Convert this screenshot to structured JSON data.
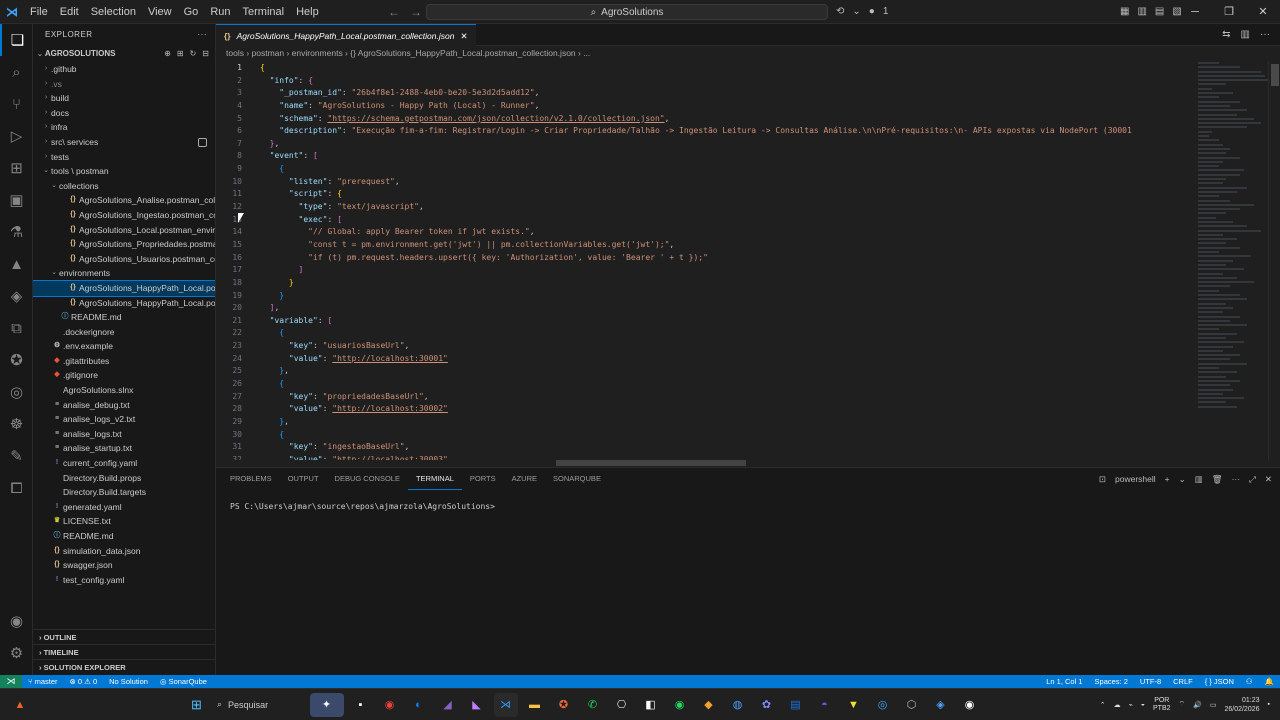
{
  "window": {
    "menu": [
      "File",
      "Edit",
      "Selection",
      "View",
      "Go",
      "Run",
      "Terminal",
      "Help"
    ],
    "search_text": "AgroSolutions",
    "notification_count": "1"
  },
  "explorer": {
    "title": "EXPLORER",
    "root": "AGROSOLUTIONS",
    "items": [
      {
        "label": ".github",
        "indent": 0,
        "chevron": "›",
        "icon": "",
        "icon_color": "#cccccc",
        "dim": false
      },
      {
        "label": ".vs",
        "indent": 0,
        "chevron": "›",
        "icon": "",
        "icon_color": "#cccccc",
        "dim": true
      },
      {
        "label": "build",
        "indent": 0,
        "chevron": "›",
        "icon": "",
        "icon_color": "#cccccc",
        "dim": false
      },
      {
        "label": "docs",
        "indent": 0,
        "chevron": "›",
        "icon": "",
        "icon_color": "#cccccc",
        "dim": false
      },
      {
        "label": "infra",
        "indent": 0,
        "chevron": "›",
        "icon": "",
        "icon_color": "#cccccc",
        "dim": false
      },
      {
        "label": "src\\ services",
        "indent": 0,
        "chevron": "›",
        "icon": "",
        "icon_color": "#cccccc",
        "dim": false,
        "badge": true
      },
      {
        "label": "tests",
        "indent": 0,
        "chevron": "›",
        "icon": "",
        "icon_color": "#cccccc",
        "dim": false
      },
      {
        "label": "tools \\ postman",
        "indent": 0,
        "chevron": "⌄",
        "icon": "",
        "icon_color": "#cccccc",
        "dim": false
      },
      {
        "label": "collections",
        "indent": 1,
        "chevron": "⌄",
        "icon": "",
        "icon_color": "#cccccc",
        "dim": false
      },
      {
        "label": "AgroSolutions_Analise.postman_collec...",
        "indent": 2,
        "chevron": "",
        "icon": "{}",
        "icon_color": "#e2c08d",
        "dim": false
      },
      {
        "label": "AgroSolutions_Ingestao.postman_coll...",
        "indent": 2,
        "chevron": "",
        "icon": "{}",
        "icon_color": "#e2c08d",
        "dim": false
      },
      {
        "label": "AgroSolutions_Local.postman_environ...",
        "indent": 2,
        "chevron": "",
        "icon": "{}",
        "icon_color": "#e2c08d",
        "dim": false
      },
      {
        "label": "AgroSolutions_Propriedades.postman...",
        "indent": 2,
        "chevron": "",
        "icon": "{}",
        "icon_color": "#e2c08d",
        "dim": false
      },
      {
        "label": "AgroSolutions_Usuarios.postman_coll...",
        "indent": 2,
        "chevron": "",
        "icon": "{}",
        "icon_color": "#e2c08d",
        "dim": false
      },
      {
        "label": "environments",
        "indent": 1,
        "chevron": "⌄",
        "icon": "",
        "icon_color": "#cccccc",
        "dim": false
      },
      {
        "label": "AgroSolutions_HappyPath_Local.post...",
        "indent": 2,
        "chevron": "",
        "icon": "{}",
        "icon_color": "#e2c08d",
        "dim": false,
        "selected": true
      },
      {
        "label": "AgroSolutions_HappyPath_Local.post...",
        "indent": 2,
        "chevron": "",
        "icon": "{}",
        "icon_color": "#e2c08d",
        "dim": false
      },
      {
        "label": "README.md",
        "indent": 1,
        "chevron": "",
        "icon": "ⓘ",
        "icon_color": "#519aba",
        "dim": false
      },
      {
        "label": ".dockerignore",
        "indent": 0,
        "chevron": "",
        "icon": "",
        "icon_color": "#cccccc",
        "dim": false
      },
      {
        "label": ".env.example",
        "indent": 0,
        "chevron": "",
        "icon": "⚙",
        "icon_color": "#cccccc",
        "dim": false
      },
      {
        "label": ".gitattributes",
        "indent": 0,
        "chevron": "",
        "icon": "◆",
        "icon_color": "#f05033",
        "dim": false
      },
      {
        "label": ".gitignore",
        "indent": 0,
        "chevron": "",
        "icon": "◆",
        "icon_color": "#f05033",
        "dim": false
      },
      {
        "label": "AgroSolutions.slnx",
        "indent": 0,
        "chevron": "",
        "icon": "",
        "icon_color": "#cccccc",
        "dim": false
      },
      {
        "label": "analise_debug.txt",
        "indent": 0,
        "chevron": "",
        "icon": "≡",
        "icon_color": "#cccccc",
        "dim": false
      },
      {
        "label": "analise_logs_v2.txt",
        "indent": 0,
        "chevron": "",
        "icon": "≡",
        "icon_color": "#cccccc",
        "dim": false
      },
      {
        "label": "analise_logs.txt",
        "indent": 0,
        "chevron": "",
        "icon": "≡",
        "icon_color": "#cccccc",
        "dim": false
      },
      {
        "label": "analise_startup.txt",
        "indent": 0,
        "chevron": "",
        "icon": "≡",
        "icon_color": "#cccccc",
        "dim": false
      },
      {
        "label": "current_config.yaml",
        "indent": 0,
        "chevron": "",
        "icon": "!",
        "icon_color": "#a074c4",
        "dim": false
      },
      {
        "label": "Directory.Build.props",
        "indent": 0,
        "chevron": "",
        "icon": "",
        "icon_color": "#cccccc",
        "dim": false
      },
      {
        "label": "Directory.Build.targets",
        "indent": 0,
        "chevron": "",
        "icon": "",
        "icon_color": "#cccccc",
        "dim": false
      },
      {
        "label": "generated.yaml",
        "indent": 0,
        "chevron": "",
        "icon": "!",
        "icon_color": "#a074c4",
        "dim": false
      },
      {
        "label": "LICENSE.txt",
        "indent": 0,
        "chevron": "",
        "icon": "♛",
        "icon_color": "#cbcb41",
        "dim": false
      },
      {
        "label": "README.md",
        "indent": 0,
        "chevron": "",
        "icon": "ⓘ",
        "icon_color": "#519aba",
        "dim": false
      },
      {
        "label": "simulation_data.json",
        "indent": 0,
        "chevron": "",
        "icon": "{}",
        "icon_color": "#e2c08d",
        "dim": false
      },
      {
        "label": "swagger.json",
        "indent": 0,
        "chevron": "",
        "icon": "{}",
        "icon_color": "#e2c08d",
        "dim": false
      },
      {
        "label": "test_config.yaml",
        "indent": 0,
        "chevron": "",
        "icon": "!",
        "icon_color": "#a074c4",
        "dim": false
      }
    ],
    "sections": [
      "OUTLINE",
      "TIMELINE",
      "SOLUTION EXPLORER"
    ]
  },
  "editor": {
    "tab_label": "AgroSolutions_HappyPath_Local.postman_collection.json",
    "breadcrumb": "tools › postman › environments › {} AgroSolutions_HappyPath_Local.postman_collection.json › ...",
    "lines": [
      [
        [
          "b1",
          "{"
        ]
      ],
      [
        [
          "p",
          "  "
        ],
        [
          "k",
          "\"info\""
        ],
        [
          "p",
          ": "
        ],
        [
          "b2",
          "{"
        ]
      ],
      [
        [
          "p",
          "    "
        ],
        [
          "k",
          "\"_postman_id\""
        ],
        [
          "p",
          ": "
        ],
        [
          "s",
          "\"26b4f8e1-2488-4eb0-be20-5e3d2d5add12\""
        ],
        [
          "p",
          ","
        ]
      ],
      [
        [
          "p",
          "    "
        ],
        [
          "k",
          "\"name\""
        ],
        [
          "p",
          ": "
        ],
        [
          "s",
          "\"AgroSolutions - Happy Path (Local) - Runner\""
        ],
        [
          "p",
          ","
        ]
      ],
      [
        [
          "p",
          "    "
        ],
        [
          "k",
          "\"schema\""
        ],
        [
          "p",
          ": "
        ],
        [
          "u",
          "\"https://schema.getpostman.com/json/collection/v2.1.0/collection.json\""
        ],
        [
          "p",
          ","
        ]
      ],
      [
        [
          "p",
          "    "
        ],
        [
          "k",
          "\"description\""
        ],
        [
          "p",
          ": "
        ],
        [
          "s",
          "\"Execução fim-a-fim: Registrar/Login -> Criar Propriedade/Talhão -> Ingestão Leitura -> Consultas Análise.\\n\\nPré-requisitos:\\n- APIs expostas via NodePort (30001"
        ]
      ],
      [
        [
          "p",
          "  "
        ],
        [
          "b2",
          "}"
        ],
        [
          "p",
          ","
        ]
      ],
      [
        [
          "p",
          "  "
        ],
        [
          "k",
          "\"event\""
        ],
        [
          "p",
          ": "
        ],
        [
          "b2",
          "["
        ]
      ],
      [
        [
          "p",
          "    "
        ],
        [
          "b3",
          "{"
        ]
      ],
      [
        [
          "p",
          "      "
        ],
        [
          "k",
          "\"listen\""
        ],
        [
          "p",
          ": "
        ],
        [
          "s",
          "\"prerequest\""
        ],
        [
          "p",
          ","
        ]
      ],
      [
        [
          "p",
          "      "
        ],
        [
          "k",
          "\"script\""
        ],
        [
          "p",
          ": "
        ],
        [
          "b1",
          "{"
        ]
      ],
      [
        [
          "p",
          "        "
        ],
        [
          "k",
          "\"type\""
        ],
        [
          "p",
          ": "
        ],
        [
          "s",
          "\"text/javascript\""
        ],
        [
          "p",
          ","
        ]
      ],
      [
        [
          "p",
          "        "
        ],
        [
          "k",
          "\"exec\""
        ],
        [
          "p",
          ": "
        ],
        [
          "b2",
          "["
        ]
      ],
      [
        [
          "p",
          "          "
        ],
        [
          "s",
          "\"// Global: apply Bearer token if jwt exists.\""
        ],
        [
          "p",
          ","
        ]
      ],
      [
        [
          "p",
          "          "
        ],
        [
          "s",
          "\"const t = pm.environment.get('jwt') || pm.collectionVariables.get('jwt');\""
        ],
        [
          "p",
          ","
        ]
      ],
      [
        [
          "p",
          "          "
        ],
        [
          "s",
          "\"if (t) pm.request.headers.upsert({ key: 'Authorization', value: 'Bearer ' + t });\""
        ]
      ],
      [
        [
          "p",
          "        "
        ],
        [
          "b2",
          "]"
        ]
      ],
      [
        [
          "p",
          "      "
        ],
        [
          "b1",
          "}"
        ]
      ],
      [
        [
          "p",
          "    "
        ],
        [
          "b3",
          "}"
        ]
      ],
      [
        [
          "p",
          "  "
        ],
        [
          "b2",
          "]"
        ],
        [
          "p",
          ","
        ]
      ],
      [
        [
          "p",
          "  "
        ],
        [
          "k",
          "\"variable\""
        ],
        [
          "p",
          ": "
        ],
        [
          "b2",
          "["
        ]
      ],
      [
        [
          "p",
          "    "
        ],
        [
          "b3",
          "{"
        ]
      ],
      [
        [
          "p",
          "      "
        ],
        [
          "k",
          "\"key\""
        ],
        [
          "p",
          ": "
        ],
        [
          "s",
          "\"usuariosBaseUrl\""
        ],
        [
          "p",
          ","
        ]
      ],
      [
        [
          "p",
          "      "
        ],
        [
          "k",
          "\"value\""
        ],
        [
          "p",
          ": "
        ],
        [
          "u",
          "\"http://localhost:30001\""
        ]
      ],
      [
        [
          "p",
          "    "
        ],
        [
          "b3",
          "}"
        ],
        [
          "p",
          ","
        ]
      ],
      [
        [
          "p",
          "    "
        ],
        [
          "b3",
          "{"
        ]
      ],
      [
        [
          "p",
          "      "
        ],
        [
          "k",
          "\"key\""
        ],
        [
          "p",
          ": "
        ],
        [
          "s",
          "\"propriedadesBaseUrl\""
        ],
        [
          "p",
          ","
        ]
      ],
      [
        [
          "p",
          "      "
        ],
        [
          "k",
          "\"value\""
        ],
        [
          "p",
          ": "
        ],
        [
          "u",
          "\"http://localhost:30002\""
        ]
      ],
      [
        [
          "p",
          "    "
        ],
        [
          "b3",
          "}"
        ],
        [
          "p",
          ","
        ]
      ],
      [
        [
          "p",
          "    "
        ],
        [
          "b3",
          "{"
        ]
      ],
      [
        [
          "p",
          "      "
        ],
        [
          "k",
          "\"key\""
        ],
        [
          "p",
          ": "
        ],
        [
          "s",
          "\"ingestaoBaseUrl\""
        ],
        [
          "p",
          ","
        ]
      ],
      [
        [
          "p",
          "      "
        ],
        [
          "k",
          "\"value\""
        ],
        [
          "p",
          ": "
        ],
        [
          "u",
          "\"http://localhost:30003\""
        ]
      ]
    ]
  },
  "panel": {
    "tabs": [
      "PROBLEMS",
      "OUTPUT",
      "DEBUG CONSOLE",
      "TERMINAL",
      "PORTS",
      "AZURE",
      "SONARQUBE"
    ],
    "active_tab": "TERMINAL",
    "shell": "powershell",
    "prompt": "PS C:\\Users\\ajmar\\source\\repos\\ajmarzola\\AgroSolutions>"
  },
  "statusbar": {
    "branch": "master",
    "errors": "0",
    "warnings": "0",
    "solution": "No Solution",
    "sonar": "SonarQube",
    "position": "Ln 1, Col 1",
    "spaces": "Spaces: 2",
    "encoding": "UTF-8",
    "eol": "CRLF",
    "language": "{ } JSON"
  },
  "taskbar": {
    "search_placeholder": "Pesquisar",
    "lang_line1": "POR",
    "lang_line2": "PTB2",
    "time": "01:23",
    "date": "26/02/2026"
  }
}
